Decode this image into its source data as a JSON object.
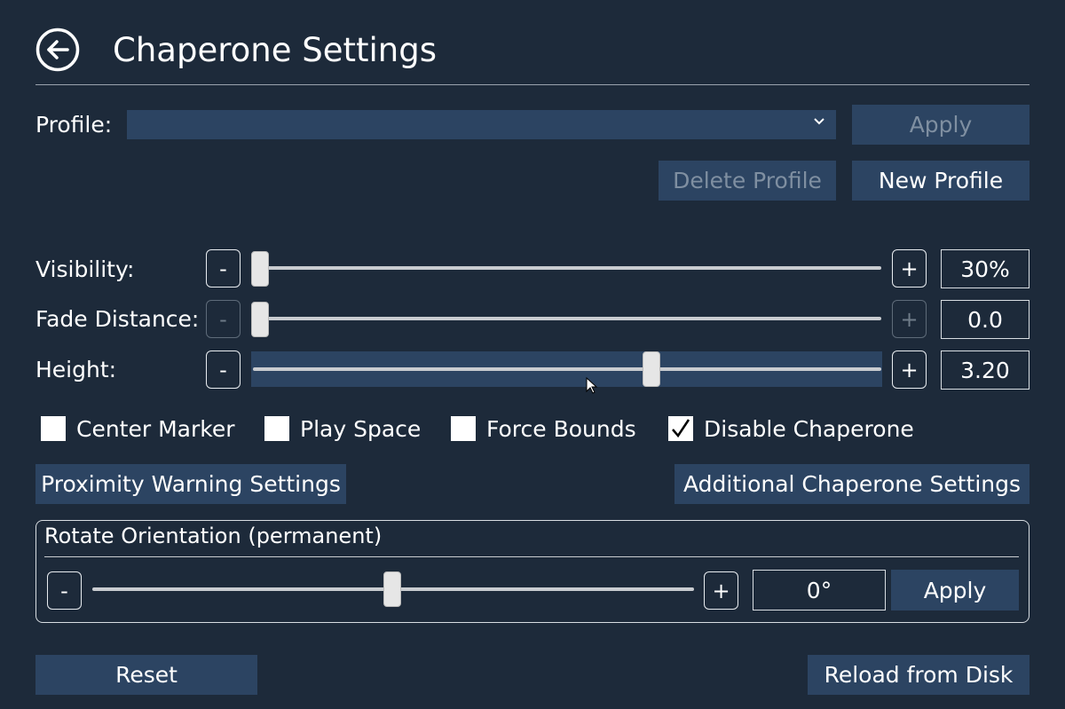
{
  "header": {
    "title": "Chaperone Settings"
  },
  "profile": {
    "label": "Profile:",
    "value": "",
    "apply_label": "Apply",
    "delete_label": "Delete Profile",
    "new_label": "New Profile"
  },
  "sliders": {
    "visibility": {
      "label": "Visibility:",
      "minus": "-",
      "plus": "+",
      "value_text": "30%",
      "position": 0.0
    },
    "fade_distance": {
      "label": "Fade Distance:",
      "minus": "-",
      "plus": "+",
      "value_text": "0.0",
      "position": 0.0
    },
    "height": {
      "label": "Height:",
      "minus": "-",
      "plus": "+",
      "value_text": "3.20",
      "position": 0.64
    }
  },
  "checkboxes": [
    {
      "label": "Center Marker",
      "checked": false
    },
    {
      "label": "Play Space",
      "checked": false
    },
    {
      "label": "Force Bounds",
      "checked": false
    },
    {
      "label": "Disable Chaperone",
      "checked": true
    }
  ],
  "buttons": {
    "proximity": "Proximity Warning Settings",
    "additional": "Additional Chaperone Settings",
    "reset": "Reset",
    "reload": "Reload from Disk"
  },
  "rotate": {
    "title": "Rotate Orientation (permanent)",
    "minus": "-",
    "plus": "+",
    "value_text": "0°",
    "apply_label": "Apply",
    "position": 0.5
  },
  "colors": {
    "background": "#1d2a3a",
    "button": "#2c4462",
    "disabled_text": "#7f8fa1"
  }
}
